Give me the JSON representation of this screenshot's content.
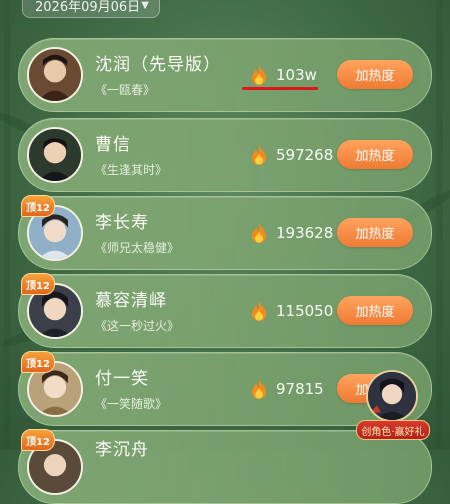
{
  "date_selector": {
    "label": "2026年09月06日",
    "caret": "▼"
  },
  "boost_label": "加热度",
  "colors": {
    "accent_orange": "#f07a33",
    "underline_red": "#e0141c",
    "card_green": "#84aa76"
  },
  "entries": [
    {
      "name": "沈润（先导版）",
      "drama": "《一瓯春》",
      "heat": "103w",
      "badge": ""
    },
    {
      "name": "曹信",
      "drama": "《生逢其时》",
      "heat": "597268",
      "badge": ""
    },
    {
      "name": "李长寿",
      "drama": "《师兄太稳健》",
      "heat": "193628",
      "badge": "顶12"
    },
    {
      "name": "慕容清峄",
      "drama": "《这一秒过火》",
      "heat": "115050",
      "badge": "顶12"
    },
    {
      "name": "付一笑",
      "drama": "《一笑随歌》",
      "heat": "97815",
      "badge": "顶12"
    },
    {
      "name": "李沉舟",
      "drama": "",
      "heat": "",
      "badge": "顶12"
    }
  ],
  "promo": {
    "label": "创角色·赢好礼",
    "icon": "character-promo-icon"
  }
}
